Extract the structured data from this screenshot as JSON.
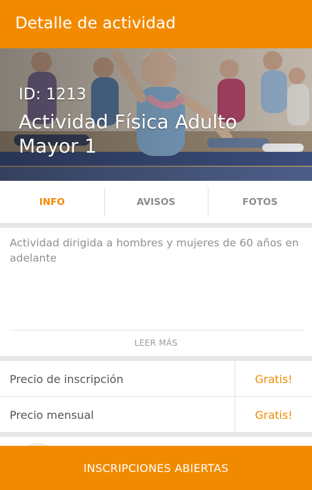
{
  "app_bar": {
    "title": "Detalle de actividad"
  },
  "activity": {
    "id_label": "ID: 1213",
    "name": "Actividad Física Adulto Mayor 1",
    "description": "Actividad dirigida a hombres y mujeres de 60 años en adelante",
    "read_more": "LEER MÁS"
  },
  "tabs": [
    {
      "label": "INFO",
      "active": true
    },
    {
      "label": "AVISOS",
      "active": false
    },
    {
      "label": "FOTOS",
      "active": false
    }
  ],
  "prices": [
    {
      "label": "Precio de inscripción",
      "value": "Gratis!"
    },
    {
      "label": "Precio mensual",
      "value": "Gratis!"
    }
  ],
  "cta": {
    "label": "INSCRIPCIONES ABIERTAS"
  },
  "colors": {
    "accent": "#F28A00",
    "tab_inactive": "#8c8c8c",
    "separator": "#e6e6e6"
  }
}
